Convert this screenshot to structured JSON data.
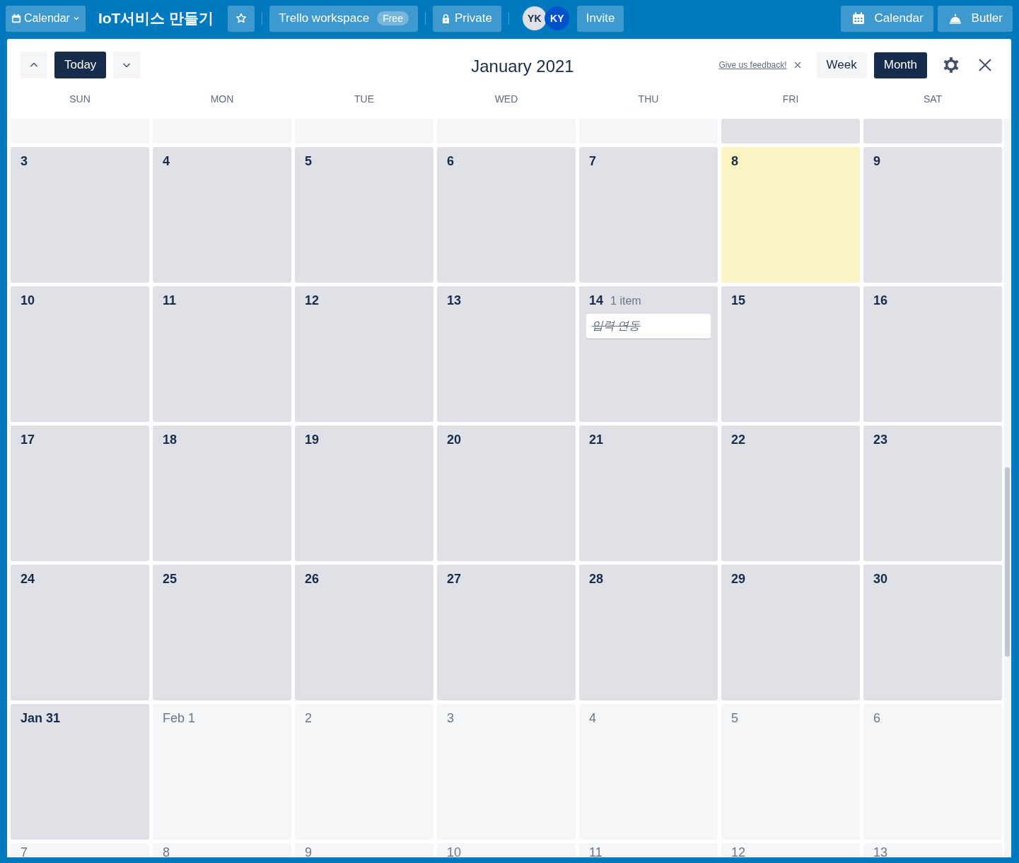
{
  "topbar": {
    "board_menu": "Calendar",
    "board_title": "IoT서비스 만들기",
    "workspace": "Trello workspace",
    "workspace_badge": "Free",
    "visibility": "Private",
    "members": [
      {
        "initials": "YK",
        "color": "#dfe1e6"
      },
      {
        "initials": "KY",
        "color": "#0052cc"
      }
    ],
    "invite": "Invite",
    "right_buttons": [
      {
        "kind": "calendar",
        "label": "Calendar"
      },
      {
        "kind": "butler",
        "label": "Butler"
      }
    ]
  },
  "calendar": {
    "today_button": "Today",
    "title": "January 2021",
    "feedback_link": "Give us feedback!",
    "views": [
      {
        "label": "Week",
        "selected": false
      },
      {
        "label": "Month",
        "selected": true
      }
    ],
    "weekdays": [
      "SUN",
      "MON",
      "TUE",
      "WED",
      "THU",
      "FRI",
      "SAT"
    ],
    "weeks": [
      [
        {
          "kind": "blank"
        },
        {
          "kind": "blank"
        },
        {
          "kind": "blank"
        },
        {
          "kind": "blank"
        },
        {
          "kind": "blank"
        },
        {
          "kind": "day",
          "current": true
        },
        {
          "kind": "day",
          "current": true
        }
      ],
      [
        {
          "label": "3",
          "current": true
        },
        {
          "label": "4",
          "current": true
        },
        {
          "label": "5",
          "current": true
        },
        {
          "label": "6",
          "current": true
        },
        {
          "label": "7",
          "current": true
        },
        {
          "label": "8",
          "current": true,
          "today": true
        },
        {
          "label": "9",
          "current": true
        }
      ],
      [
        {
          "label": "10",
          "current": true
        },
        {
          "label": "11",
          "current": true
        },
        {
          "label": "12",
          "current": true
        },
        {
          "label": "13",
          "current": true
        },
        {
          "label": "14",
          "current": true,
          "count": "1 item",
          "cards": [
            {
              "title": "입력 연동",
              "done": true
            }
          ]
        },
        {
          "label": "15",
          "current": true
        },
        {
          "label": "16",
          "current": true
        }
      ],
      [
        {
          "label": "17",
          "current": true
        },
        {
          "label": "18",
          "current": true
        },
        {
          "label": "19",
          "current": true
        },
        {
          "label": "20",
          "current": true
        },
        {
          "label": "21",
          "current": true
        },
        {
          "label": "22",
          "current": true
        },
        {
          "label": "23",
          "current": true
        }
      ],
      [
        {
          "label": "24",
          "current": true
        },
        {
          "label": "25",
          "current": true
        },
        {
          "label": "26",
          "current": true
        },
        {
          "label": "27",
          "current": true
        },
        {
          "label": "28",
          "current": true
        },
        {
          "label": "29",
          "current": true
        },
        {
          "label": "30",
          "current": true
        }
      ],
      [
        {
          "label": "Jan 31",
          "current": true
        },
        {
          "label": "Feb 1",
          "current": false
        },
        {
          "label": "2",
          "current": false
        },
        {
          "label": "3",
          "current": false
        },
        {
          "label": "4",
          "current": false
        },
        {
          "label": "5",
          "current": false
        },
        {
          "label": "6",
          "current": false
        }
      ],
      [
        {
          "label": "7",
          "current": false
        },
        {
          "label": "8",
          "current": false
        },
        {
          "label": "9",
          "current": false
        },
        {
          "label": "10",
          "current": false
        },
        {
          "label": "11",
          "current": false
        },
        {
          "label": "12",
          "current": false
        },
        {
          "label": "13",
          "current": false
        }
      ]
    ]
  }
}
